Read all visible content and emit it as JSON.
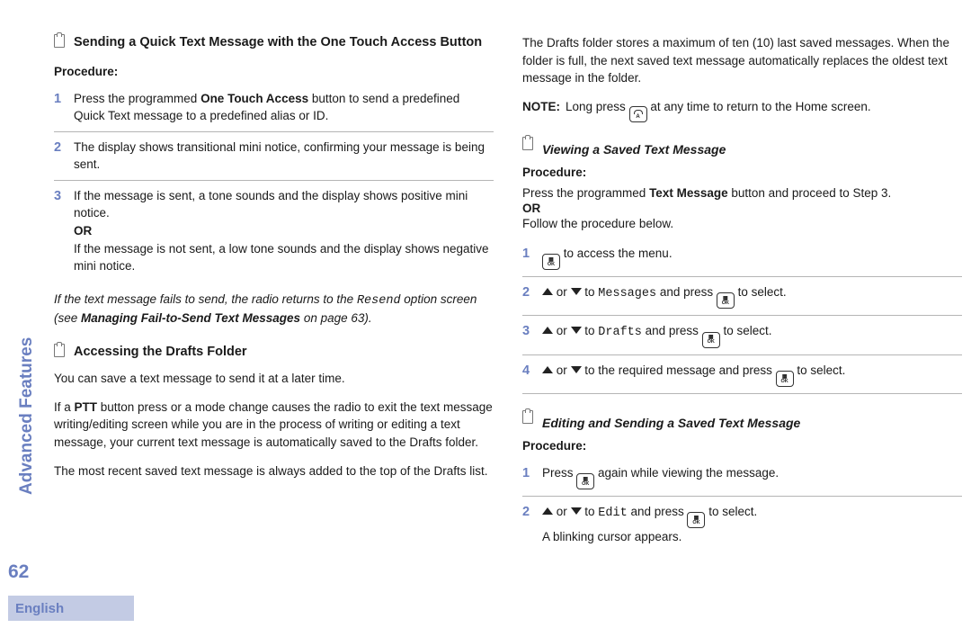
{
  "meta": {
    "sideLabel": "Advanced Features",
    "pageNumber": "62",
    "language": "English"
  },
  "left": {
    "heading1": "Sending a Quick Text Message with the One Touch Access Button",
    "procedureLabel": "Procedure:",
    "steps": [
      {
        "n": "1",
        "prefix": "Press the programmed ",
        "bold": "One Touch Access",
        "suffix": " button to send a predefined Quick Text message to a predefined alias or ID."
      },
      {
        "n": "2",
        "text": "The display shows transitional mini notice, confirming your message is being sent."
      },
      {
        "n": "3",
        "line1": "If the message is sent, a tone sounds and the display shows positive mini notice.",
        "or": "OR",
        "line2": "If the message is not sent, a low tone sounds and the display shows negative mini notice."
      }
    ],
    "failNote": {
      "p1": "If the text message fails to send, the radio returns to the ",
      "mono": "Resend",
      "p2": " option screen (see ",
      "bold": "Managing Fail-to-Send Text Messages",
      "p3": " on page 63)."
    },
    "heading2": "Accessing the Drafts Folder",
    "paraA": "You can save a text message to send it at a later time.",
    "paraB": {
      "p1": "If a ",
      "bold": "PTT",
      "p2": " button press or a mode change causes the radio to exit the text message writing/editing screen while you are in the process of writing or editing a text message, your current text message is automatically saved to the Drafts folder."
    },
    "paraC": "The most recent saved text message is always added to the top of the Drafts list."
  },
  "right": {
    "paraTop": "The Drafts folder stores a maximum of ten (10) last saved messages. When the folder is full, the next saved text message automatically replaces the oldest text message in the folder.",
    "note": {
      "label": "NOTE:",
      "p1": "Long press ",
      "p2": " at any time to return to the Home screen."
    },
    "heading3": "Viewing a Saved Text Message",
    "procLabel": "Procedure:",
    "intro1": {
      "p1": "Press the programmed ",
      "bold": "Text Message",
      "p2": " button and proceed to Step 3."
    },
    "or": "OR",
    "intro2": "Follow the procedure below.",
    "stepsA": [
      {
        "n": "1",
        "suffix": " to access the menu."
      },
      {
        "n": "2",
        "mid": " to ",
        "mono": "Messages",
        "tail": " and press ",
        "end": " to select."
      },
      {
        "n": "3",
        "mid": " to ",
        "mono": "Drafts",
        "tail": " and press ",
        "end": " to select."
      },
      {
        "n": "4",
        "mid": " to the required message and press ",
        "end": " to select."
      }
    ],
    "heading4": "Editing and Sending a Saved Text Message",
    "procLabel2": "Procedure:",
    "stepsB": [
      {
        "n": "1",
        "pre": "Press ",
        "post": " again while viewing the message."
      },
      {
        "n": "2",
        "mid": " to ",
        "mono": "Edit",
        "tail": " and press ",
        "end": " to select.",
        "extra": "A blinking cursor appears."
      }
    ]
  }
}
